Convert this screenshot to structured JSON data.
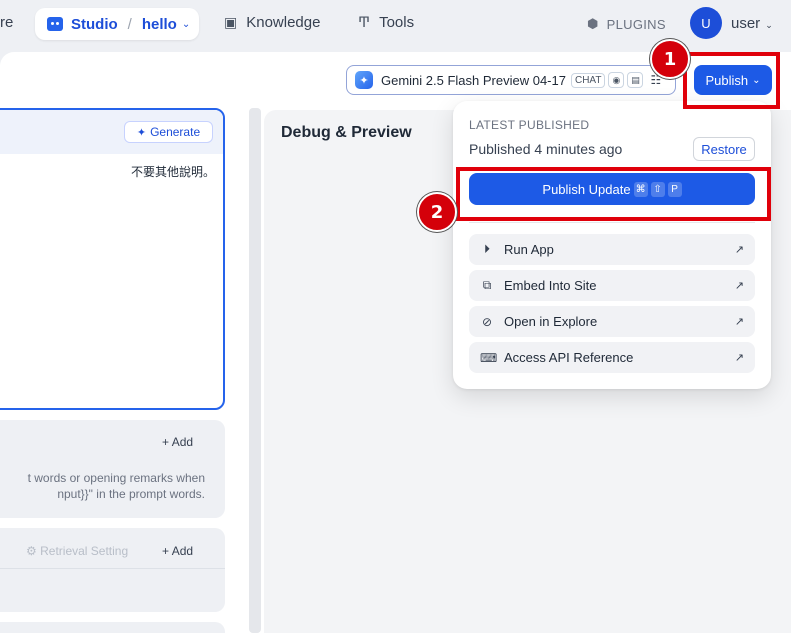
{
  "nav": {
    "cut_label": "re",
    "studio_label": "Studio",
    "app_name": "hello",
    "knowledge_label": "Knowledge",
    "tools_label": "Tools",
    "plugins_label": "PLUGINS",
    "avatar_initial": "U",
    "user_label": "user"
  },
  "toolbar": {
    "model_name": "Gemini 2.5 Flash Preview 04-17",
    "model_mode_badge": "CHAT",
    "publish_label": "Publish"
  },
  "orchestrate": {
    "generate_label": "Generate",
    "prompt_text": "不要其他說明。",
    "variables_add_label": "Add",
    "variables_desc_line1": "t words or opening remarks when",
    "variables_desc_line2": "nput}}\" in the prompt words.",
    "retrieval_setting_label": "Retrieval Setting",
    "context_add_label": "Add"
  },
  "debug": {
    "title": "Debug & Preview",
    "cut_text": ")"
  },
  "publish_menu": {
    "caption": "LATEST PUBLISHED",
    "status": "Published 4 minutes ago",
    "restore_label": "Restore",
    "publish_update_label": "Publish Update",
    "shortcut_keys": [
      "⌘",
      "⇧",
      "P"
    ],
    "items": [
      {
        "label": "Run App",
        "icon": "play-circle-icon"
      },
      {
        "label": "Embed Into Site",
        "icon": "embed-icon"
      },
      {
        "label": "Open in Explore",
        "icon": "explore-icon"
      },
      {
        "label": "Access API Reference",
        "icon": "terminal-icon"
      }
    ]
  },
  "annotations": {
    "step1": "1",
    "step2": "2",
    "color": "#e0000a"
  },
  "colors": {
    "primary": "#1d5ae6",
    "background": "#eef0f4"
  }
}
